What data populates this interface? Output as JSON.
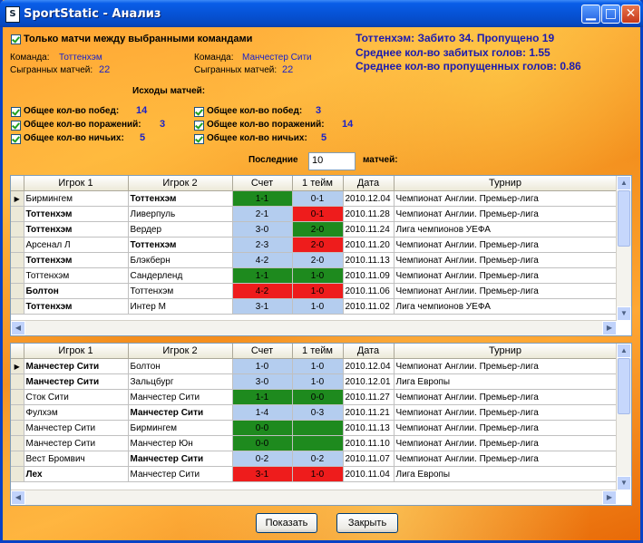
{
  "window": {
    "title": "SportStatic - Анализ",
    "icon_letter": "S"
  },
  "filters": {
    "only_between_label": "Только матчи между выбранными командами",
    "team_label": "Команда:",
    "played_label": "Сыгранных матчей:",
    "team1": "Тоттенхэм",
    "team1_played": "22",
    "team2": "Манчестер Сити",
    "team2_played": "22",
    "outcomes_header": "Исходы матчей:",
    "wins_label": "Общее кол-во побед:",
    "losses_label": "Общее кол-во поражений:",
    "draws_label": "Общее кол-во ничьих:",
    "team1_wins": "14",
    "team1_losses": "3",
    "team1_draws": "5",
    "team2_wins": "3",
    "team2_losses": "14",
    "team2_draws": "5",
    "last_label": "Последние",
    "last_value": "10",
    "matches_label": "матчей:"
  },
  "stats": {
    "line1": "Тоттенхэм: Забито 34. Пропущено 19",
    "line2": "Среднее кол-во забитых голов: 1.55",
    "line3": "Среднее кол-во пропущенных голов: 0.86"
  },
  "columns": [
    "Игрок 1",
    "Игрок 2",
    "Счет",
    "1 тейм",
    "Дата",
    "Турнир"
  ],
  "colors": {
    "green": "#1e8a1e",
    "red": "#ee1c1c",
    "blue": "#b4cdef"
  },
  "grid1": [
    {
      "p1": "Бирмингем",
      "p2": "Тоттенхэм",
      "score": "1-1",
      "half": "0-1",
      "date": "2010.12.04",
      "tour": "Чемпионат Англии. Премьер-лига",
      "b": 2,
      "sc": "green",
      "hc": "blue"
    },
    {
      "p1": "Тоттенхэм",
      "p2": "Ливерпуль",
      "score": "2-1",
      "half": "0-1",
      "date": "2010.11.28",
      "tour": "Чемпионат Англии. Премьер-лига",
      "b": 1,
      "sc": "blue",
      "hc": "red"
    },
    {
      "p1": "Тоттенхэм",
      "p2": "Вердер",
      "score": "3-0",
      "half": "2-0",
      "date": "2010.11.24",
      "tour": "Лига чемпионов УЕФА",
      "b": 1,
      "sc": "blue",
      "hc": "green"
    },
    {
      "p1": "Арсенал Л",
      "p2": "Тоттенхэм",
      "score": "2-3",
      "half": "2-0",
      "date": "2010.11.20",
      "tour": "Чемпионат Англии. Премьер-лига",
      "b": 2,
      "sc": "blue",
      "hc": "red"
    },
    {
      "p1": "Тоттенхэм",
      "p2": "Блэкберн",
      "score": "4-2",
      "half": "2-0",
      "date": "2010.11.13",
      "tour": "Чемпионат Англии. Премьер-лига",
      "b": 1,
      "sc": "blue",
      "hc": "blue"
    },
    {
      "p1": "Тоттенхэм",
      "p2": "Сандерленд",
      "score": "1-1",
      "half": "1-0",
      "date": "2010.11.09",
      "tour": "Чемпионат Англии. Премьер-лига",
      "b": 0,
      "sc": "green",
      "hc": "green"
    },
    {
      "p1": "Болтон",
      "p2": "Тоттенхэм",
      "score": "4-2",
      "half": "1-0",
      "date": "2010.11.06",
      "tour": "Чемпионат Англии. Премьер-лига",
      "b": 1,
      "sc": "red",
      "hc": "red"
    },
    {
      "p1": "Тоттенхэм",
      "p2": "Интер М",
      "score": "3-1",
      "half": "1-0",
      "date": "2010.11.02",
      "tour": "Лига чемпионов УЕФА",
      "b": 1,
      "sc": "blue",
      "hc": "blue"
    }
  ],
  "grid2": [
    {
      "p1": "Манчестер Сити",
      "p2": "Болтон",
      "score": "1-0",
      "half": "1-0",
      "date": "2010.12.04",
      "tour": "Чемпионат Англии. Премьер-лига",
      "b": 1,
      "sc": "blue",
      "hc": "blue"
    },
    {
      "p1": "Манчестер Сити",
      "p2": "Зальцбург",
      "score": "3-0",
      "half": "1-0",
      "date": "2010.12.01",
      "tour": "Лига Европы",
      "b": 1,
      "sc": "blue",
      "hc": "blue"
    },
    {
      "p1": "Сток Сити",
      "p2": "Манчестер Сити",
      "score": "1-1",
      "half": "0-0",
      "date": "2010.11.27",
      "tour": "Чемпионат Англии. Премьер-лига",
      "b": 0,
      "sc": "green",
      "hc": "green"
    },
    {
      "p1": "Фулхэм",
      "p2": "Манчестер Сити",
      "score": "1-4",
      "half": "0-3",
      "date": "2010.11.21",
      "tour": "Чемпионат Англии. Премьер-лига",
      "b": 2,
      "sc": "blue",
      "hc": "blue"
    },
    {
      "p1": "Манчестер Сити",
      "p2": "Бирмингем",
      "score": "0-0",
      "half": "",
      "date": "2010.11.13",
      "tour": "Чемпионат Англии. Премьер-лига",
      "b": 0,
      "sc": "green",
      "hc": "green"
    },
    {
      "p1": "Манчестер Сити",
      "p2": "Манчестер Юн",
      "score": "0-0",
      "half": "",
      "date": "2010.11.10",
      "tour": "Чемпионат Англии. Премьер-лига",
      "b": 0,
      "sc": "green",
      "hc": "green"
    },
    {
      "p1": "Вест Бромвич",
      "p2": "Манчестер Сити",
      "score": "0-2",
      "half": "0-2",
      "date": "2010.11.07",
      "tour": "Чемпионат Англии. Премьер-лига",
      "b": 2,
      "sc": "blue",
      "hc": "blue"
    },
    {
      "p1": "Лех",
      "p2": "Манчестер Сити",
      "score": "3-1",
      "half": "1-0",
      "date": "2010.11.04",
      "tour": "Лига Европы",
      "b": 1,
      "sc": "red",
      "hc": "red"
    }
  ],
  "buttons": {
    "show": "Показать",
    "close": "Закрыть"
  }
}
